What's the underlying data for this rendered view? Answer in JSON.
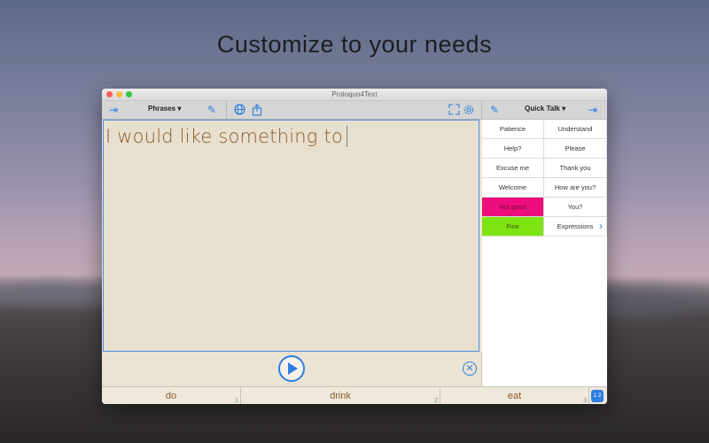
{
  "headline": "Customize to your needs",
  "window": {
    "title": "Proloquo4Text"
  },
  "toolbar": {
    "collapse_left_icon": "arrow-to-right-icon",
    "phrases_menu": "Phrases ▾",
    "edit_icon": "pencil-icon",
    "globe_icon": "globe-icon",
    "share_icon": "share-icon",
    "fullscreen_icon": "expand-icon",
    "settings_icon": "gear-icon",
    "right_edit_icon": "pencil-icon",
    "quick_talk_menu": "Quick Talk ▾",
    "collapse_right_icon": "arrow-to-right-icon"
  },
  "editor": {
    "text": "I would like something to"
  },
  "controls": {
    "play_icon": "play-icon",
    "clear_icon": "close-circle-icon"
  },
  "predictions": [
    {
      "word": "do",
      "num": "1"
    },
    {
      "word": "drink",
      "num": "2"
    },
    {
      "word": "eat",
      "num": "3"
    }
  ],
  "predictions_badge": "1 2",
  "quick_talk": [
    [
      "Patience",
      "Understand"
    ],
    [
      "Help?",
      "Please"
    ],
    [
      "Excuse me",
      "Thank you"
    ],
    [
      "Welcome",
      "How are you?"
    ],
    [
      "Not good",
      "You?"
    ],
    [
      "Fine",
      "Expressions"
    ]
  ],
  "colors": {
    "accent": "#2f7de1",
    "not_good": "#ed0e7d",
    "fine": "#7ee312",
    "text_brown": "#8a5a2a"
  }
}
